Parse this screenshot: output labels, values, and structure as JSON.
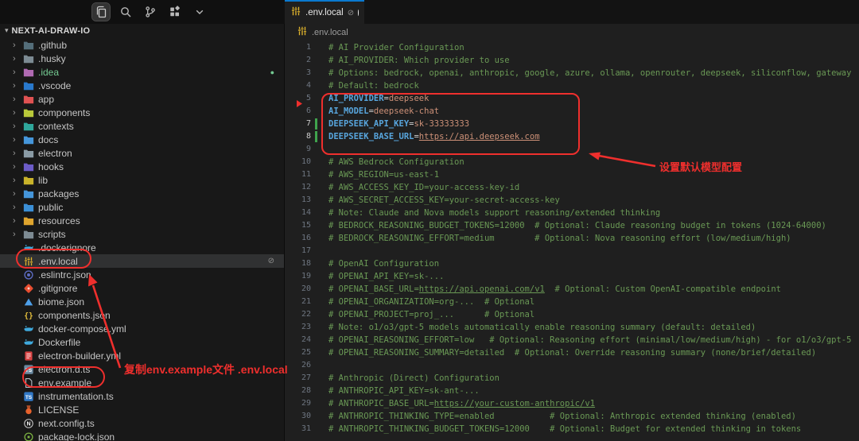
{
  "header": {
    "icons": [
      {
        "name": "files-icon",
        "active": true
      },
      {
        "name": "search-icon",
        "active": false
      },
      {
        "name": "source-control-icon",
        "active": false
      },
      {
        "name": "extensions-icon",
        "active": false
      },
      {
        "name": "chevron-down-icon",
        "active": false
      }
    ]
  },
  "tab": {
    "title": ".env.local",
    "gitignored_symbol": "⊘",
    "modified": true,
    "file_icon": "env"
  },
  "breadcrumb": {
    "file": ".env.local",
    "file_icon": "env"
  },
  "sidebar": {
    "root": "NEXT-AI-DRAW-IO",
    "items": [
      {
        "label": ".github",
        "kind": "folder",
        "icon": "folder",
        "color": "#546e7a"
      },
      {
        "label": ".husky",
        "kind": "folder",
        "icon": "folder",
        "color": "#7d8b93"
      },
      {
        "label": ".idea",
        "kind": "folder",
        "icon": "folder",
        "color": "#b06ab2",
        "label_color": "#73c991",
        "badge": "dot"
      },
      {
        "label": ".vscode",
        "kind": "folder",
        "icon": "folder",
        "color": "#2979cc"
      },
      {
        "label": "app",
        "kind": "folder",
        "icon": "folder",
        "color": "#e05252"
      },
      {
        "label": "components",
        "kind": "folder",
        "icon": "folder",
        "color": "#b9c93a"
      },
      {
        "label": "contexts",
        "kind": "folder",
        "icon": "folder",
        "color": "#2fa79b"
      },
      {
        "label": "docs",
        "kind": "folder",
        "icon": "folder",
        "color": "#4596db"
      },
      {
        "label": "electron",
        "kind": "folder",
        "icon": "folder",
        "color": "#8a9ba5"
      },
      {
        "label": "hooks",
        "kind": "folder",
        "icon": "folder",
        "color": "#6c5cc7"
      },
      {
        "label": "lib",
        "kind": "folder",
        "icon": "folder",
        "color": "#c9b32a"
      },
      {
        "label": "packages",
        "kind": "folder",
        "icon": "folder",
        "color": "#4596db"
      },
      {
        "label": "public",
        "kind": "folder",
        "icon": "folder",
        "color": "#3b8fd6"
      },
      {
        "label": "resources",
        "kind": "folder",
        "icon": "folder",
        "color": "#e0a52e"
      },
      {
        "label": "scripts",
        "kind": "folder",
        "icon": "folder",
        "color": "#7d8b93"
      },
      {
        "label": ".dockerignore",
        "kind": "file",
        "icon": "whale",
        "color": "#3fa9dc"
      },
      {
        "label": ".env.local",
        "kind": "file",
        "icon": "env",
        "color": "#e3b62c",
        "selected": true,
        "badge": "⊘"
      },
      {
        "label": ".eslintrc.json",
        "kind": "file",
        "icon": "eslint",
        "color": "#5c6bc0"
      },
      {
        "label": ".gitignore",
        "kind": "file",
        "icon": "gitd",
        "color": "#e84e31"
      },
      {
        "label": "biome.json",
        "kind": "file",
        "icon": "tri",
        "color": "#4d9fe8"
      },
      {
        "label": "components.json",
        "kind": "file",
        "icon": "braces",
        "color": "#e8c23d"
      },
      {
        "label": "docker-compose.yml",
        "kind": "file",
        "icon": "whale",
        "color": "#3fa9dc"
      },
      {
        "label": "Dockerfile",
        "kind": "file",
        "icon": "whale",
        "color": "#3fa9dc"
      },
      {
        "label": "electron-builder.yml",
        "kind": "file",
        "icon": "ebuild",
        "color": "#d84343"
      },
      {
        "label": "electron.d.ts",
        "kind": "file",
        "icon": "ts",
        "color": "#6a89a0"
      },
      {
        "label": "env.example",
        "kind": "file",
        "icon": "fileo",
        "color": "#b5bdc4"
      },
      {
        "label": "instrumentation.ts",
        "kind": "file",
        "icon": "ts",
        "color": "#3178c6"
      },
      {
        "label": "LICENSE",
        "kind": "file",
        "icon": "medal",
        "color": "#e8622c"
      },
      {
        "label": "next.config.ts",
        "kind": "file",
        "icon": "next",
        "color": "#cccccc"
      },
      {
        "label": "package-lock.json",
        "kind": "file",
        "icon": "npml",
        "color": "#7cb342"
      }
    ]
  },
  "editor": {
    "lines": [
      {
        "n": 1,
        "segs": [
          [
            "com",
            "# AI Provider Configuration"
          ]
        ]
      },
      {
        "n": 2,
        "segs": [
          [
            "com",
            "# AI_PROVIDER: Which provider to use"
          ]
        ]
      },
      {
        "n": 3,
        "segs": [
          [
            "com",
            "# Options: bedrock, openai, anthropic, google, azure, ollama, openrouter, deepseek, siliconflow, gateway"
          ]
        ]
      },
      {
        "n": 4,
        "segs": [
          [
            "com",
            "# Default: bedrock"
          ]
        ]
      },
      {
        "n": 5,
        "segs": [
          [
            "key",
            "AI_PROVIDER"
          ],
          [
            "op",
            "="
          ],
          [
            "val",
            "deepseek"
          ]
        ]
      },
      {
        "n": 6,
        "marker": true,
        "segs": [
          [
            "key",
            "AI_MODEL"
          ],
          [
            "op",
            "="
          ],
          [
            "val",
            "deepseek-chat"
          ]
        ]
      },
      {
        "n": 7,
        "active": true,
        "git": true,
        "segs": [
          [
            "key",
            "DEEPSEEK_API_KEY"
          ],
          [
            "op",
            "="
          ],
          [
            "val",
            "sk-33333333"
          ]
        ]
      },
      {
        "n": 8,
        "active": true,
        "git": true,
        "segs": [
          [
            "key",
            "DEEPSEEK_BASE_URL"
          ],
          [
            "op",
            "="
          ],
          [
            "url",
            "https://api.deepseek.com"
          ]
        ]
      },
      {
        "n": 9,
        "segs": []
      },
      {
        "n": 10,
        "segs": [
          [
            "com",
            "# AWS Bedrock Configuration"
          ]
        ]
      },
      {
        "n": 11,
        "segs": [
          [
            "com",
            "# AWS_REGION=us-east-1"
          ]
        ]
      },
      {
        "n": 12,
        "segs": [
          [
            "com",
            "# AWS_ACCESS_KEY_ID=your-access-key-id"
          ]
        ]
      },
      {
        "n": 13,
        "segs": [
          [
            "com",
            "# AWS_SECRET_ACCESS_KEY=your-secret-access-key"
          ]
        ]
      },
      {
        "n": 14,
        "segs": [
          [
            "com",
            "# Note: Claude and Nova models support reasoning/extended thinking"
          ]
        ]
      },
      {
        "n": 15,
        "segs": [
          [
            "com",
            "# BEDROCK_REASONING_BUDGET_TOKENS=12000  # Optional: Claude reasoning budget in tokens (1024-64000)"
          ]
        ]
      },
      {
        "n": 16,
        "segs": [
          [
            "com",
            "# BEDROCK_REASONING_EFFORT=medium        # Optional: Nova reasoning effort (low/medium/high)"
          ]
        ]
      },
      {
        "n": 17,
        "segs": []
      },
      {
        "n": 18,
        "segs": [
          [
            "com",
            "# OpenAI Configuration"
          ]
        ]
      },
      {
        "n": 19,
        "segs": [
          [
            "com",
            "# OPENAI_API_KEY=sk-..."
          ]
        ]
      },
      {
        "n": 20,
        "segs": [
          [
            "com",
            "# OPENAI_BASE_URL="
          ],
          [
            "comu",
            "https://api.openai.com/v1"
          ],
          [
            "com",
            "  # Optional: Custom OpenAI-compatible endpoint"
          ]
        ]
      },
      {
        "n": 21,
        "segs": [
          [
            "com",
            "# OPENAI_ORGANIZATION=org-...  # Optional"
          ]
        ]
      },
      {
        "n": 22,
        "segs": [
          [
            "com",
            "# OPENAI_PROJECT=proj_...      # Optional"
          ]
        ]
      },
      {
        "n": 23,
        "segs": [
          [
            "com",
            "# Note: o1/o3/gpt-5 models automatically enable reasoning summary (default: detailed)"
          ]
        ]
      },
      {
        "n": 24,
        "segs": [
          [
            "com",
            "# OPENAI_REASONING_EFFORT=low   # Optional: Reasoning effort (minimal/low/medium/high) - for o1/o3/gpt-5"
          ]
        ]
      },
      {
        "n": 25,
        "segs": [
          [
            "com",
            "# OPENAI_REASONING_SUMMARY=detailed  # Optional: Override reasoning summary (none/brief/detailed)"
          ]
        ]
      },
      {
        "n": 26,
        "segs": []
      },
      {
        "n": 27,
        "segs": [
          [
            "com",
            "# Anthropic (Direct) Configuration"
          ]
        ]
      },
      {
        "n": 28,
        "segs": [
          [
            "com",
            "# ANTHROPIC_API_KEY=sk-ant-..."
          ]
        ]
      },
      {
        "n": 29,
        "segs": [
          [
            "com",
            "# ANTHROPIC_BASE_URL="
          ],
          [
            "comu",
            "https://your-custom-anthropic/v1"
          ]
        ]
      },
      {
        "n": 30,
        "segs": [
          [
            "com",
            "# ANTHROPIC_THINKING_TYPE=enabled           # Optional: Anthropic extended thinking (enabled)"
          ]
        ]
      },
      {
        "n": 31,
        "segs": [
          [
            "com",
            "# ANTHROPIC_THINKING_BUDGET_TOKENS=12000    # Optional: Budget for extended thinking in tokens"
          ]
        ]
      }
    ]
  },
  "annotations": {
    "accent": "#ef2f2d",
    "model_config_label": "设置默认模型配置",
    "copy_env_label": "复制env.example文件 .env.local"
  }
}
